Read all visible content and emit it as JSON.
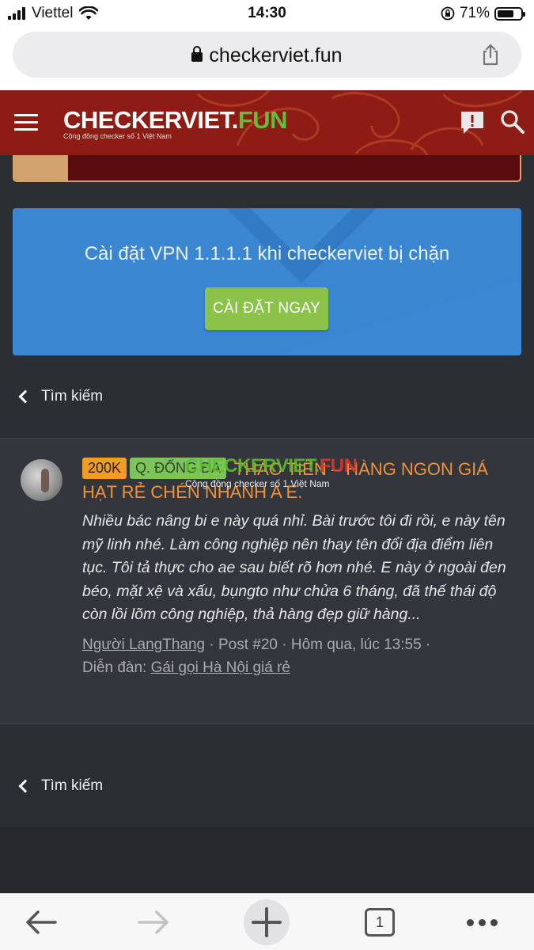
{
  "statusbar": {
    "carrier": "Viettel",
    "time": "14:30",
    "battery": "71%",
    "battery_level": 0.71
  },
  "browser": {
    "url": "checkerviet.fun",
    "tab_count": "1"
  },
  "site": {
    "logo_main": "CHECKERVIET.",
    "logo_accent": "FUN",
    "logo_tagline": "Cộng đồng checker số 1 Việt Nam"
  },
  "vpn_banner": {
    "text": "Cài đặt VPN 1.1.1.1 khi checkerviet bị chặn",
    "button": "CÀI ĐẶT NGAY"
  },
  "search_back_top": "Tìm kiếm",
  "search_back_bottom": "Tìm kiếm",
  "result": {
    "tag_price": "200K",
    "tag_area": "Q. ĐỐNG ĐA",
    "title": "THẢO TIÊN – HÀNG NGON GIÁ HẠT RẺ CHÉN NHANH A E.",
    "excerpt": "Nhiều bác nâng bi e này quá nhỉ. Bài trước tôi đi rồi, e này tên mỹ linh nhé. Làm công nghiệp nên thay tên đổi địa điểm liên tục. Tôi tả thực cho ae sau biết rõ hơn nhé. E này ở ngoài đen béo, mặt xệ và xấu, bụngto như chửa 6 tháng, đã thế thái độ còn lồi lõm công nghiệp, thả hàng đẹp giữ hàng...",
    "author": "Người LangThang",
    "post": "Post #20",
    "time": "Hôm qua, lúc 13:55",
    "forum_label": "Diễn đàn:",
    "forum": "Gái gọi Hà Nội giá rẻ",
    "watermark_main": "CHECKERVIET.",
    "watermark_accent": "FUN",
    "watermark_sub": "Cộng đồng checker số 1 Việt Nam"
  },
  "colors": {
    "header_red": "#8c1c14",
    "banner_blue": "#3a86d1",
    "button_green": "#8bc34a",
    "title_orange": "#f0923a",
    "tag_orange": "#f39c25",
    "tag_green": "#7cc35a"
  }
}
